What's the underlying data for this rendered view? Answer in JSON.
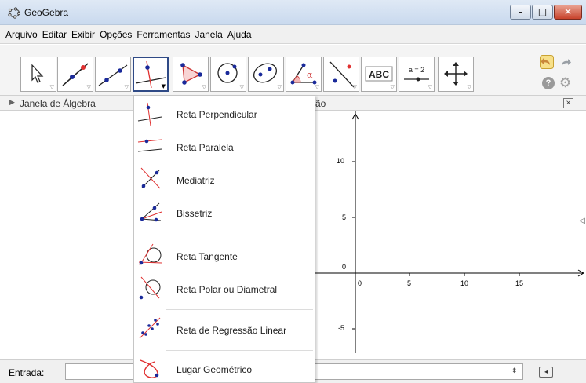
{
  "window": {
    "title": "GeoGebra",
    "icon": "geogebra-logo-icon",
    "controls": {
      "minimize": "–",
      "maximize": "□",
      "close": "✕"
    }
  },
  "menubar": {
    "items": [
      "Arquivo",
      "Editar",
      "Exibir",
      "Opções",
      "Ferramentas",
      "Janela",
      "Ajuda"
    ]
  },
  "toolbar": {
    "tools": [
      {
        "name": "move-tool",
        "icon": "cursor-arrow-icon",
        "label": ""
      },
      {
        "name": "point-tool",
        "icon": "point-on-line-icon",
        "label": ""
      },
      {
        "name": "line-tool",
        "icon": "line-through-points-icon",
        "label": ""
      },
      {
        "name": "perpendicular-tool",
        "icon": "perpendicular-line-icon",
        "label": "",
        "active": true
      },
      {
        "name": "polygon-tool",
        "icon": "polygon-icon",
        "label": ""
      },
      {
        "name": "circle-tool",
        "icon": "circle-center-point-icon",
        "label": ""
      },
      {
        "name": "ellipse-tool",
        "icon": "ellipse-icon",
        "label": ""
      },
      {
        "name": "angle-tool",
        "icon": "angle-icon",
        "label": "α"
      },
      {
        "name": "reflect-tool",
        "icon": "reflect-line-icon",
        "label": ""
      },
      {
        "name": "text-tool",
        "icon": "text-abc-icon",
        "label": "ABC"
      },
      {
        "name": "slider-tool",
        "icon": "slider-icon",
        "label": "a = 2"
      },
      {
        "name": "move-view-tool",
        "icon": "move-graphics-view-icon",
        "label": ""
      }
    ],
    "undo_icon": "undo-icon",
    "redo_icon": "redo-icon",
    "help_label": "?",
    "settings_icon": "gear-icon"
  },
  "views": {
    "algebra_title": "Janela de Álgebra",
    "graphics_title_visible": "ão",
    "close_label": "×"
  },
  "graphics": {
    "x_ticks": [
      "0",
      "5",
      "10",
      "15"
    ],
    "y_ticks": [
      "10",
      "5",
      "0",
      "-5"
    ]
  },
  "dropdown": {
    "items": [
      {
        "icon": "perpendicular-line-icon",
        "label": "Reta Perpendicular"
      },
      {
        "icon": "parallel-line-icon",
        "label": "Reta Paralela"
      },
      {
        "icon": "perpendicular-bisector-icon",
        "label": "Mediatriz"
      },
      {
        "icon": "angle-bisector-icon",
        "label": "Bissetriz"
      },
      {
        "icon": "tangent-line-icon",
        "label": "Reta Tangente"
      },
      {
        "icon": "polar-diameter-line-icon",
        "label": "Reta Polar ou Diametral"
      },
      {
        "icon": "linear-regression-icon",
        "label": "Reta de Regressão Linear"
      },
      {
        "icon": "locus-icon",
        "label": "Lugar Geométrico"
      }
    ]
  },
  "inputbar": {
    "label": "Entrada:",
    "value": "",
    "spinner": "⬍",
    "help_button": "◂"
  },
  "colors": {
    "active_tool_border": "#2f4a86",
    "point_blue": "#1a2a9a",
    "line_red": "#e03030",
    "titlebar": "#c9d9ee"
  }
}
